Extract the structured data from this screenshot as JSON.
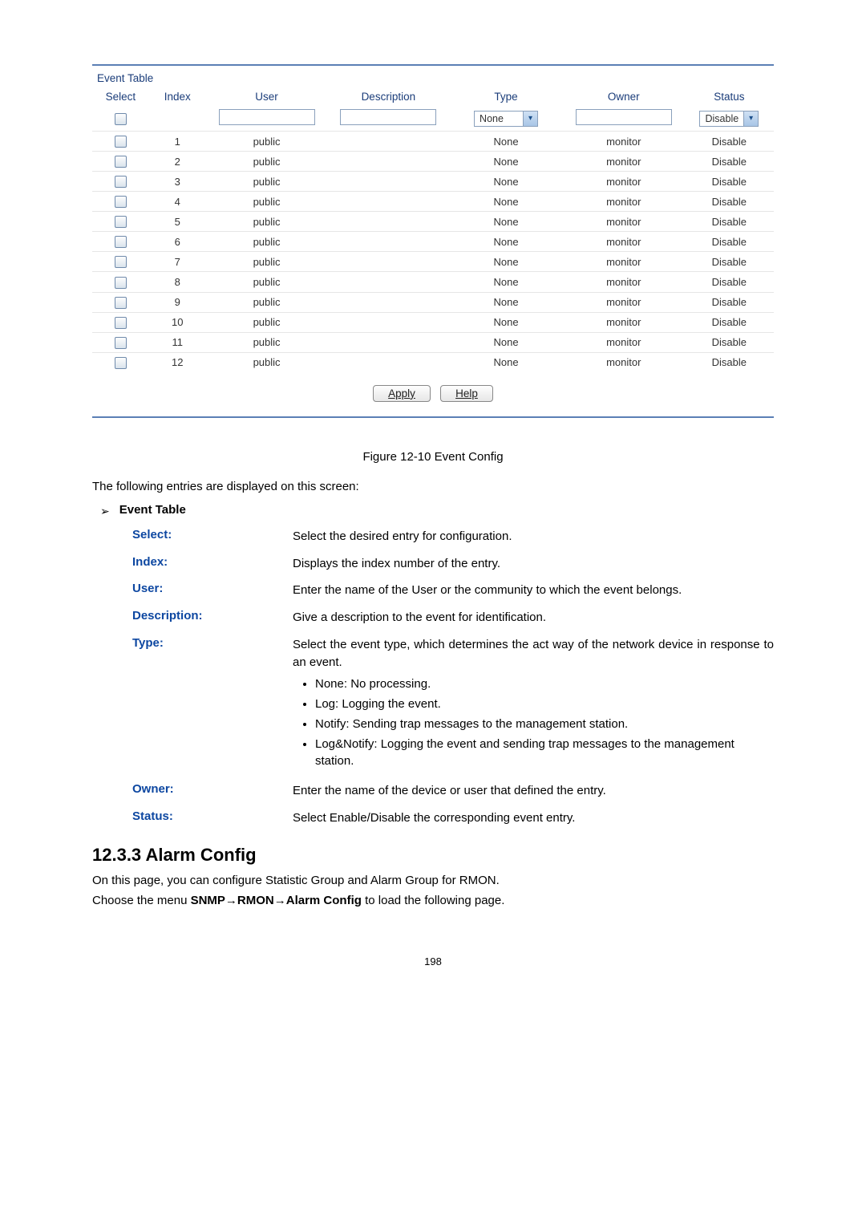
{
  "table": {
    "title": "Event Table",
    "headers": {
      "select": "Select",
      "index": "Index",
      "user": "User",
      "description": "Description",
      "type": "Type",
      "owner": "Owner",
      "status": "Status"
    },
    "inputs": {
      "type_selected": "None",
      "status_selected": "Disable"
    },
    "rows": [
      {
        "index": "1",
        "user": "public",
        "description": "",
        "type": "None",
        "owner": "monitor",
        "status": "Disable"
      },
      {
        "index": "2",
        "user": "public",
        "description": "",
        "type": "None",
        "owner": "monitor",
        "status": "Disable"
      },
      {
        "index": "3",
        "user": "public",
        "description": "",
        "type": "None",
        "owner": "monitor",
        "status": "Disable"
      },
      {
        "index": "4",
        "user": "public",
        "description": "",
        "type": "None",
        "owner": "monitor",
        "status": "Disable"
      },
      {
        "index": "5",
        "user": "public",
        "description": "",
        "type": "None",
        "owner": "monitor",
        "status": "Disable"
      },
      {
        "index": "6",
        "user": "public",
        "description": "",
        "type": "None",
        "owner": "monitor",
        "status": "Disable"
      },
      {
        "index": "7",
        "user": "public",
        "description": "",
        "type": "None",
        "owner": "monitor",
        "status": "Disable"
      },
      {
        "index": "8",
        "user": "public",
        "description": "",
        "type": "None",
        "owner": "monitor",
        "status": "Disable"
      },
      {
        "index": "9",
        "user": "public",
        "description": "",
        "type": "None",
        "owner": "monitor",
        "status": "Disable"
      },
      {
        "index": "10",
        "user": "public",
        "description": "",
        "type": "None",
        "owner": "monitor",
        "status": "Disable"
      },
      {
        "index": "11",
        "user": "public",
        "description": "",
        "type": "None",
        "owner": "monitor",
        "status": "Disable"
      },
      {
        "index": "12",
        "user": "public",
        "description": "",
        "type": "None",
        "owner": "monitor",
        "status": "Disable"
      }
    ],
    "buttons": {
      "apply": "Apply",
      "help": "Help"
    }
  },
  "figure_caption": "Figure 12-10 Event Config",
  "intro": "The following entries are displayed on this screen:",
  "section_name": "Event Table",
  "defs": {
    "select_label": "Select:",
    "select_desc": "Select the desired entry for configuration.",
    "index_label": "Index:",
    "index_desc": "Displays the index number of the entry.",
    "user_label": "User:",
    "user_desc": "Enter the name of the User or the community to which the event belongs.",
    "description_label": "Description:",
    "description_desc": "Give a description to the event for identification.",
    "type_label": "Type:",
    "type_desc": "Select the event type, which determines the act way of the network device in response to an event.",
    "type_items": {
      "a": "None: No processing.",
      "b": "Log: Logging the event.",
      "c": "Notify: Sending trap messages to the management station.",
      "d": "Log&Notify: Logging the event and sending trap messages to the management station."
    },
    "owner_label": "Owner:",
    "owner_desc": "Enter the name of the device or user that defined the entry.",
    "status_label": "Status:",
    "status_desc": "Select Enable/Disable the corresponding event entry."
  },
  "heading": "12.3.3  Alarm Config",
  "para1": "On this page, you can configure Statistic Group and Alarm Group for RMON.",
  "para2_pre": "Choose the menu ",
  "para2_bold": "SNMP→RMON→Alarm Config",
  "para2_post": " to load the following page.",
  "page_number": "198"
}
